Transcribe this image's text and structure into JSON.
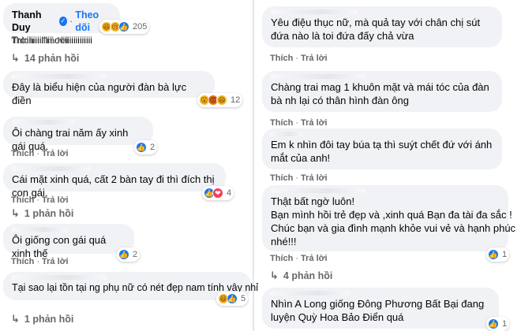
{
  "left": {
    "c1": {
      "author": "Thanh Duy",
      "dot": "·",
      "follow": "Theo dõi",
      "text": "Trờiiiiiiiiiiii ơiiiiiiiiiiiiiii",
      "reaction_count": "205",
      "actions": {
        "like": "Thích",
        "reply": "Trả lời"
      },
      "replies": "14 phản hồi"
    },
    "c2": {
      "text": "Đây là biểu hiện của người đàn bà lực điền",
      "reaction_count": "12"
    },
    "c3": {
      "text": "Ôi chàng trai năm ấy xinh gái quá.",
      "reaction_count": "2",
      "actions": {
        "like": "Thích",
        "reply": "Trả lời"
      }
    },
    "c4": {
      "text": "Cái mặt xinh quá, cất 2 bàn tay đi thì đích thị con gái.",
      "reaction_count": "4",
      "actions": {
        "like": "Thích",
        "reply": "Trả lời"
      },
      "replies": "1 phản hồi"
    },
    "c5": {
      "text": "Ôi giống con gái quá xinh thế",
      "reaction_count": "2",
      "actions": {
        "like": "Thích",
        "reply": "Trả lời"
      }
    },
    "c6": {
      "text": "Tại sao lại tồn tại ng phụ nữ có nét đẹp nam tính vậy nhỉ",
      "reaction_count": "5",
      "replies": "1 phản hồi"
    }
  },
  "right": {
    "c1": {
      "text": "Yêu điệu thục nữ, mà quả tay với chân chị sút đứa nào là toi đứa đấy chả vừa",
      "actions": {
        "like": "Thích",
        "reply": "Trả lời"
      }
    },
    "c2": {
      "text": "Chàng trai mag 1 khuôn mặt và mái tóc của đàn bà nh lại có thân hình đàn ông",
      "actions": {
        "like": "Thích",
        "reply": "Trả lời"
      }
    },
    "c3": {
      "text": "Em k nhìn đôi tay búa tạ thì suýt chết đứ với ánh mắt của anh!",
      "actions": {
        "like": "Thích",
        "reply": "Trả lời"
      }
    },
    "c4": {
      "lines": [
        "Thật bất ngờ luôn!",
        "Bạn mình hồi trẻ đẹp và ,xinh quá Bạn đa tài đa sắc !",
        "Chúc bạn và gia đình mạnh khỏe vui vẻ và hạnh phúc",
        "nhé!!!"
      ],
      "reaction_count": "1",
      "actions": {
        "like": "Thích",
        "reply": "Trả lời"
      },
      "replies": "4 phản hồi"
    },
    "c5": {
      "text": "Nhìn A Long giống Đông Phương Bất Bại đang luyện Quỳ Hoa Bảo Điển quá",
      "reaction_count": "1"
    }
  },
  "icons": {
    "like": "like-icon",
    "haha": "haha-icon",
    "love": "love-icon",
    "wow": "wow-icon",
    "sad": "sad-icon",
    "angry": "angry-icon",
    "reply_arrow": "reply-arrow-icon",
    "verified": "verified-icon"
  },
  "colors": {
    "bubble": "#f0f2f5",
    "link": "#1877f2",
    "muted": "#65676b",
    "like": "#1877f2",
    "love": "#f33e58",
    "haha": "#f7b928"
  }
}
